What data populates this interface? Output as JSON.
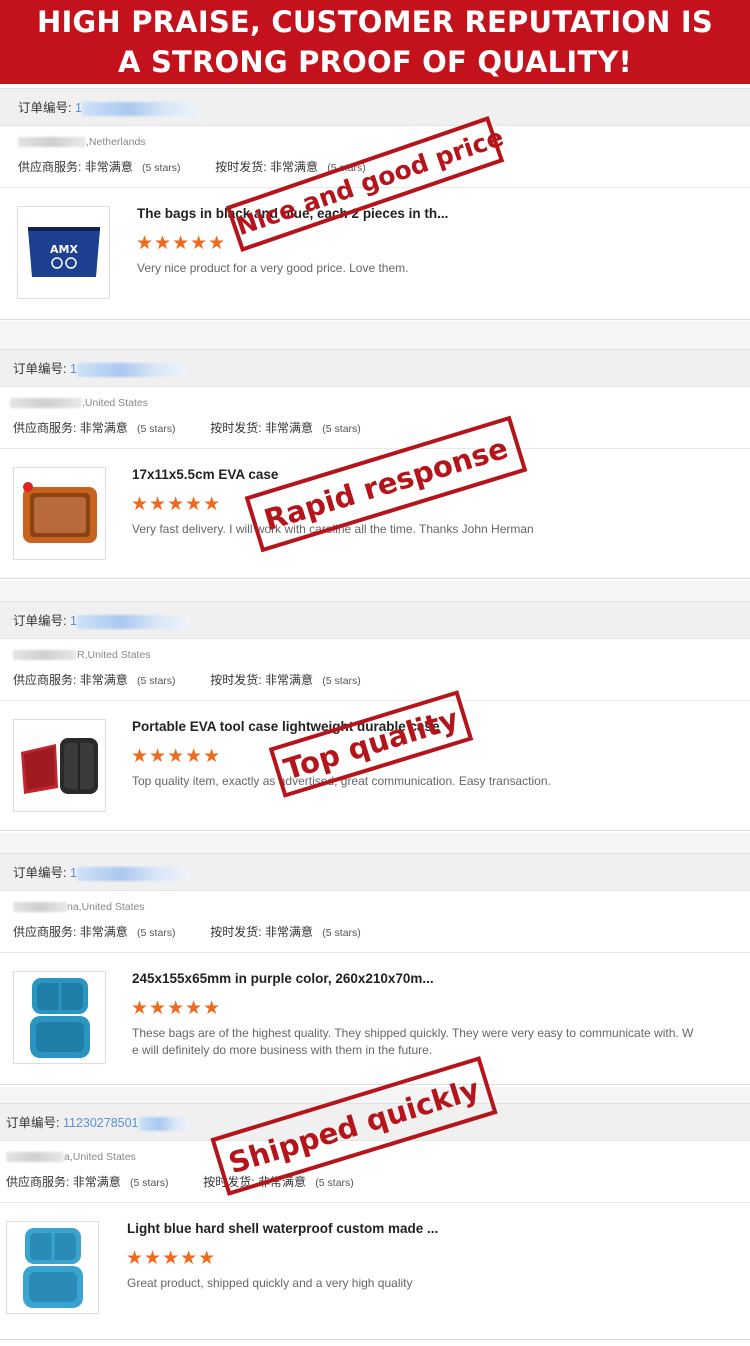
{
  "banner": {
    "line1": "HIGH PRAISE, CUSTOMER REPUTATION IS",
    "line2": "A STRONG PROOF OF QUALITY!"
  },
  "labels": {
    "order_no": "订单编号:",
    "supplier_service": "供应商服务:",
    "on_time_delivery": "按时发货:",
    "satisfied": "非常满意",
    "five_stars": "(5 stars)"
  },
  "colors": {
    "banner_red": "#c4121d",
    "stamp_red": "#b4141a",
    "star_orange": "#ef6a1c",
    "order_link_blue": "#5b8fd6"
  },
  "reviews": [
    {
      "order_number": "1",
      "country": ",Netherlands",
      "title": "The bags in black and blue, each 2 pieces in th...",
      "stars": "★★★★★",
      "rating": 5,
      "comment": "Very nice product for a very good price. Love them.",
      "stamp": "Nice and good price",
      "thumb_icon": "blue-zipper-pouch-icon",
      "thumb_text": "AMX"
    },
    {
      "order_number": "1",
      "country": ",United States",
      "title": "17x11x5.5cm EVA case",
      "stars": "★★★★★",
      "rating": 5,
      "comment": "Very fast delivery. I will work with caroline all the time. Thanks John Herman",
      "stamp": "Rapid response",
      "thumb_icon": "orange-open-case-icon"
    },
    {
      "order_number": "1",
      "country": "R,United States",
      "title": "Portable EVA tool case lightweight durable case",
      "stars": "★★★★★",
      "rating": 5,
      "comment": "Top quality item, exactly as advertised, great communication. Easy transaction.",
      "stamp": "Top quality",
      "thumb_icon": "red-black-case-icon"
    },
    {
      "order_number": "1",
      "country": "na,United States",
      "title": "245x155x65mm in purple color, 260x210x70m...",
      "stars": "★★★★★",
      "rating": 5,
      "comment": "These bags are of the highest quality.  They shipped quickly. They were very easy to communicate with.  W",
      "comment2": "e will definitely do more business with them in the future.",
      "stamp": "",
      "thumb_icon": "blue-open-case-icon"
    },
    {
      "order_number": "11230278501",
      "country": "a,United States",
      "title": "Light blue hard shell waterproof custom made ...",
      "stars": "★★★★★",
      "rating": 5,
      "comment": "Great product, shipped quickly and a very high quality",
      "stamp": "Shipped quickly",
      "thumb_icon": "light-blue-case-icon"
    }
  ]
}
